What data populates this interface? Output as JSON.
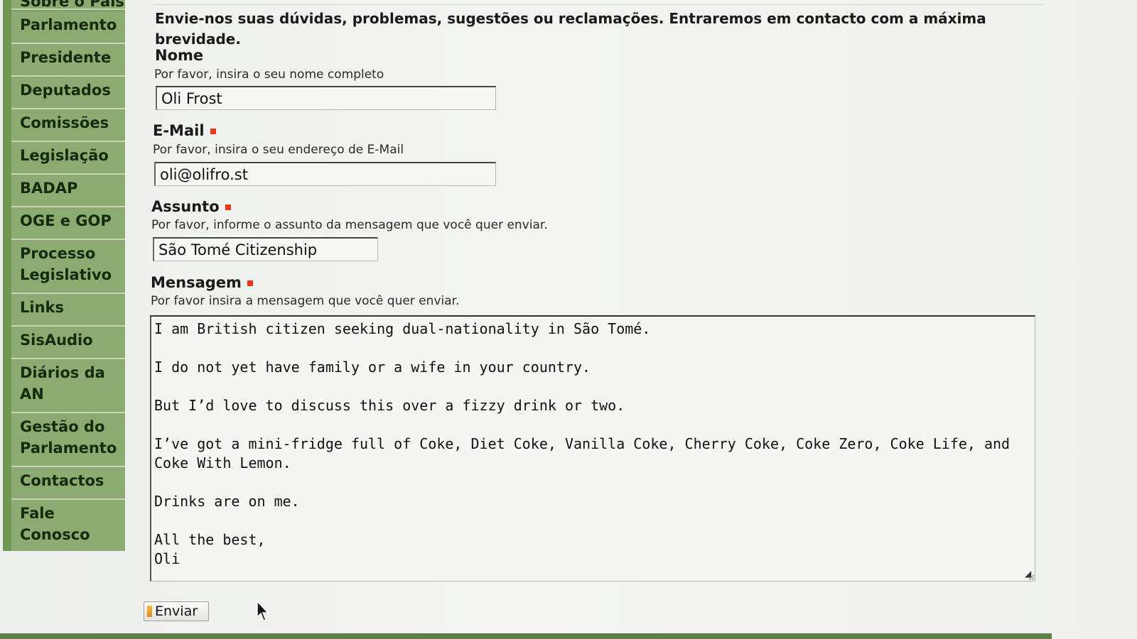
{
  "sidebar": {
    "top_partial_label": "Sobre o País",
    "items": [
      {
        "label": "Parlamento"
      },
      {
        "label": "Presidente"
      },
      {
        "label": "Deputados"
      },
      {
        "label": "Comissões"
      },
      {
        "label": "Legislação"
      },
      {
        "label": "BADAP"
      },
      {
        "label": "OGE e GOP"
      },
      {
        "label": "Processo\nLegislativo"
      },
      {
        "label": "Links"
      },
      {
        "label": "SisAudio"
      },
      {
        "label": "Diários da\nAN"
      },
      {
        "label": "Gestão do\nParlamento"
      },
      {
        "label": "Contactos"
      },
      {
        "label": "Fale\nConosco"
      }
    ]
  },
  "form": {
    "intro": "Envie-nos suas dúvidas, problemas, sugestões ou reclamações. Entraremos em contacto com a máxima brevidade.",
    "name": {
      "label": "Nome",
      "help": "Por favor, insira o seu nome completo",
      "value": "Oli Frost"
    },
    "email": {
      "label": "E-Mail",
      "help": "Por favor, insira o seu endereço de E-Mail",
      "value": "oli@olifro.st"
    },
    "subject": {
      "label": "Assunto",
      "help": "Por favor, informe o assunto da mensagem que você quer enviar.",
      "value": "São Tomé Citizenship"
    },
    "message": {
      "label": "Mensagem",
      "help": "Por favor insira a mensagem que você quer enviar.",
      "value": "I am British citizen seeking dual-nationality in São Tomé.\n\nI do not yet have family or a wife in your country.\n\nBut I’d love to discuss this over a fizzy drink or two.\n\nI’ve got a mini-fridge full of Coke, Diet Coke, Vanilla Coke, Cherry Coke, Coke Zero, Coke Life, and\nCoke With Lemon.\n\nDrinks are on me.\n\nAll the best,\nOli"
    },
    "submit_label": "Enviar"
  },
  "colors": {
    "sidebar_green": "#8cab70",
    "required_marker": "#e83a17"
  }
}
